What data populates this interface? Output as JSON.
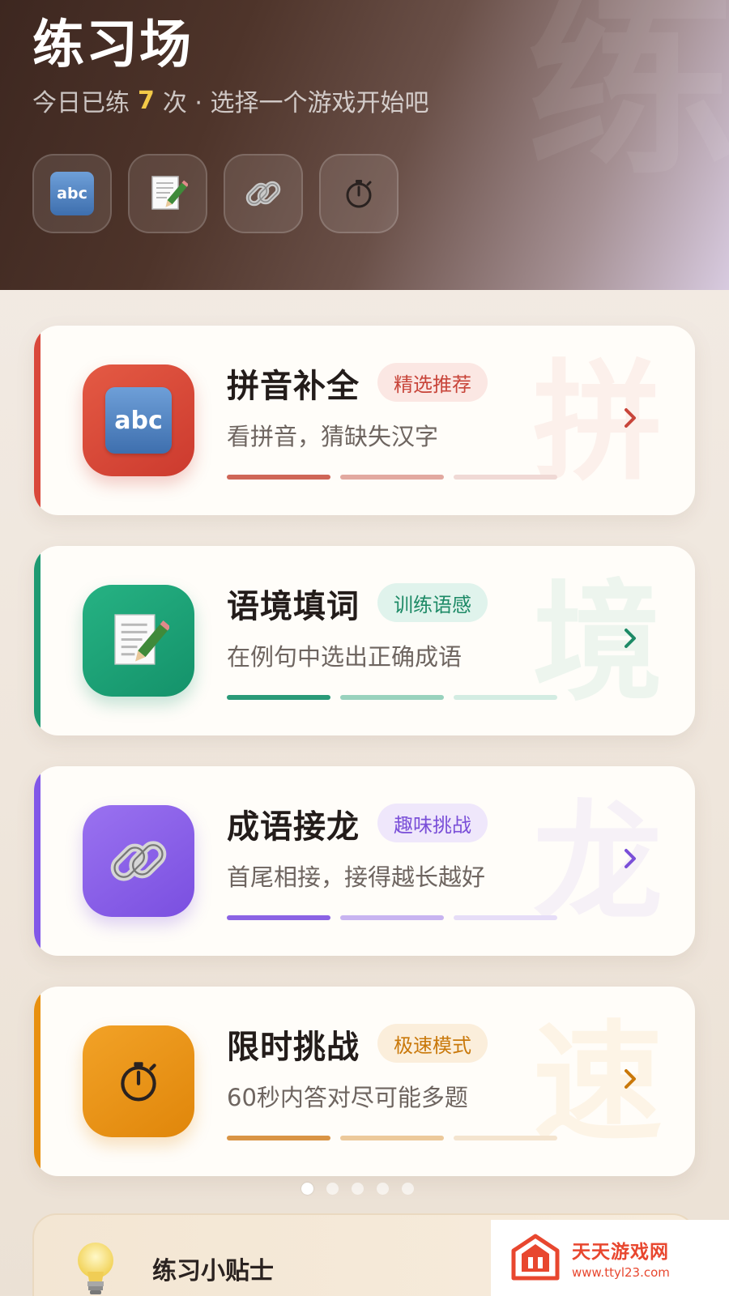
{
  "header": {
    "title": "练习场",
    "watermark": "练",
    "subtitle_prefix": "今日已练",
    "practice_count": "7",
    "subtitle_suffix": "次 · 选择一个游戏开始吧",
    "quick_icons": [
      "abc-icon",
      "memo-icon",
      "link-icon",
      "stopwatch-icon"
    ],
    "abc_text": "abc"
  },
  "games": [
    {
      "title": "拼音补全",
      "badge": "精选推荐",
      "desc": "看拼音，猜缺失汉字",
      "watermark": "拼",
      "icon": "abc-icon",
      "accent": "#d9483b",
      "badge_bg": "#fbe7e3",
      "badge_color": "#c8453a",
      "bar_colors": [
        "#cf6657",
        "#e2a9a0",
        "#f0d9d5"
      ]
    },
    {
      "title": "语境填词",
      "badge": "训练语感",
      "desc": "在例句中选出正确成语",
      "watermark": "境",
      "icon": "memo-icon",
      "accent": "#1e9a72",
      "badge_bg": "#e0f3ec",
      "badge_color": "#1d8a66",
      "bar_colors": [
        "#2a9a78",
        "#99d2bd",
        "#d3ece2"
      ]
    },
    {
      "title": "成语接龙",
      "badge": "趣味挑战",
      "desc": "首尾相接，接得越长越好",
      "watermark": "龙",
      "icon": "link-icon",
      "accent": "#8157e8",
      "badge_bg": "#efe7fb",
      "badge_color": "#7a4fd8",
      "bar_colors": [
        "#8b63e4",
        "#c8b4f0",
        "#e6ddf7"
      ]
    },
    {
      "title": "限时挑战",
      "badge": "极速模式",
      "desc": "60秒内答对尽可能多题",
      "watermark": "速",
      "icon": "stopwatch-icon",
      "accent": "#e8900f",
      "badge_bg": "#fbeedb",
      "badge_color": "#c9780a",
      "bar_colors": [
        "#d99445",
        "#ecc99b",
        "#f4e4cf"
      ]
    }
  ],
  "tips": {
    "title": "练习小贴士"
  },
  "site_watermark": {
    "name": "天天游戏网",
    "url": "www.ttyl23.com"
  }
}
